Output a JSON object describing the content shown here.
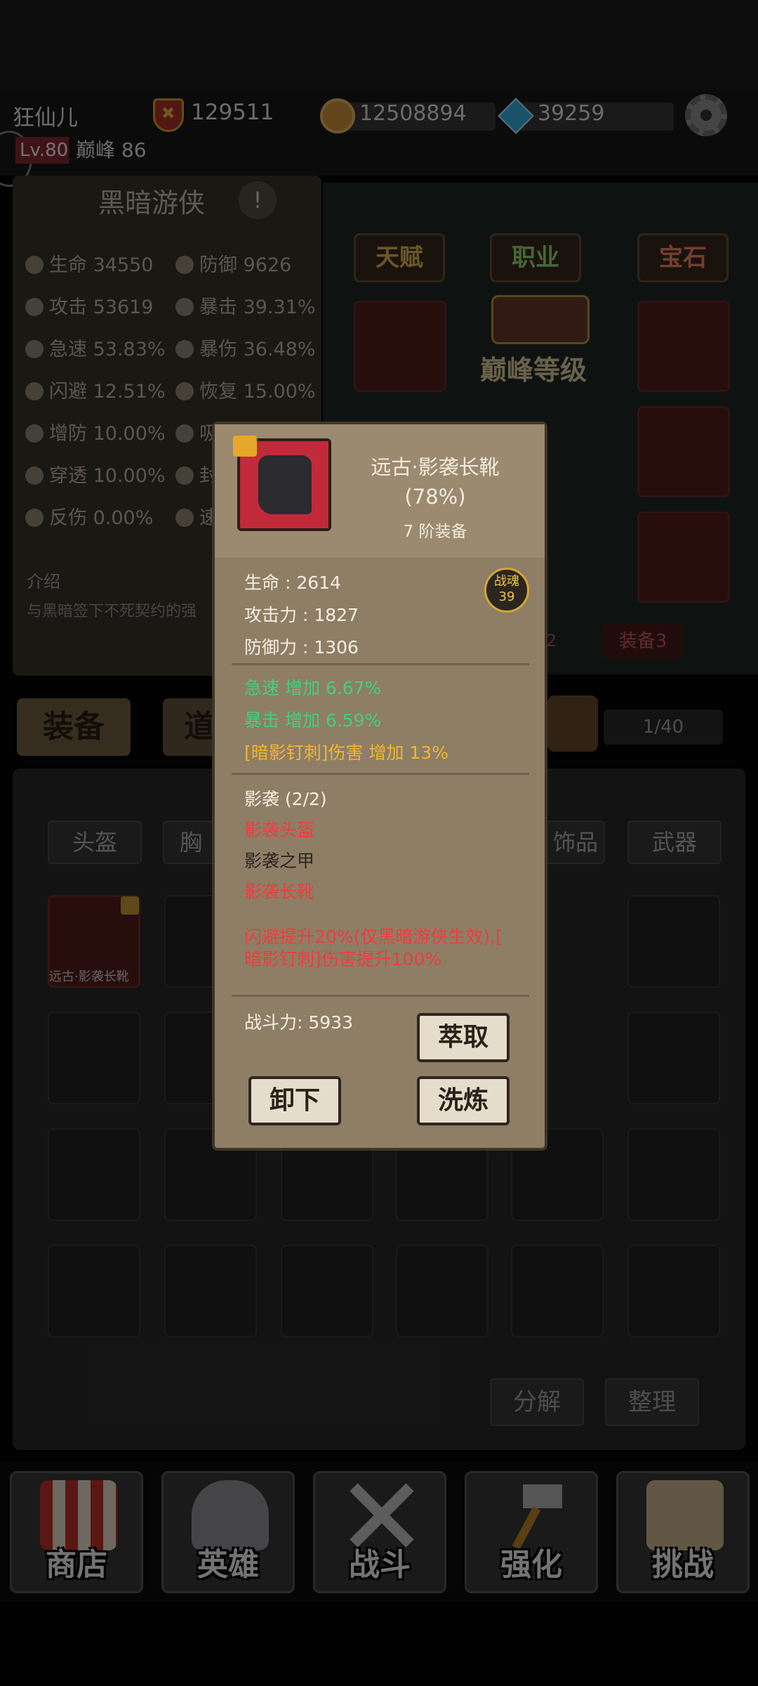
{
  "header": {
    "player_name": "狂仙儿",
    "combat_power": "129511",
    "level": "Lv.80",
    "peak": "巅峰 86",
    "gold": "12508894",
    "gems": "39259"
  },
  "hero_panel": {
    "class_name": "黑暗游侠",
    "info_icon": "!",
    "stats": [
      {
        "label": "生命 34550",
        "icon": "heart-icon"
      },
      {
        "label": "防御 9626",
        "icon": "shield-icon"
      },
      {
        "label": "攻击 53619",
        "icon": "sword-icon"
      },
      {
        "label": "暴击 39.31%",
        "icon": "crit-icon"
      },
      {
        "label": "急速 53.83%",
        "icon": "haste-icon"
      },
      {
        "label": "暴伤 36.48%",
        "icon": "critdmg-icon"
      },
      {
        "label": "闪避 12.51%",
        "icon": "dodge-icon"
      },
      {
        "label": "恢复 15.00%",
        "icon": "heal-icon"
      },
      {
        "label": "增防 10.00%",
        "icon": "defup-icon"
      },
      {
        "label": "吸",
        "icon": "lifesteal-icon"
      },
      {
        "label": "穿透 10.00%",
        "icon": "pierce-icon"
      },
      {
        "label": "封",
        "icon": "seal-icon"
      },
      {
        "label": "反伤 0.00%",
        "icon": "reflect-icon"
      },
      {
        "label": "速",
        "icon": "speed-icon"
      }
    ],
    "intro_label": "介绍",
    "intro_text": "与黑暗签下不死契约的强"
  },
  "right_menu": {
    "talent": "天赋",
    "job": "职业",
    "gem": "宝石",
    "peak_level": "巅峰等级",
    "equip_tab_partial": "2",
    "equip3": "装备3"
  },
  "tabs": {
    "equip": "装备",
    "item": "道",
    "capacity": "1/40"
  },
  "inventory": {
    "categories": [
      "头盔",
      "胸",
      "饰品",
      "武器"
    ],
    "first_item_label": "远古·影袭长靴",
    "decompose": "分解",
    "sort": "整理"
  },
  "nav": [
    {
      "label": "商店",
      "icon": "shop-icon"
    },
    {
      "label": "英雄",
      "icon": "hero-helmet-icon"
    },
    {
      "label": "战斗",
      "icon": "crossed-swords-icon"
    },
    {
      "label": "强化",
      "icon": "hammer-icon"
    },
    {
      "label": "挑战",
      "icon": "challenge-map-icon"
    }
  ],
  "popup": {
    "item_name": "远古·影袭长靴",
    "percent": "(78%)",
    "tier": "7 阶装备",
    "soul_label": "战魂",
    "soul_value": "39",
    "base_stats": [
      "生命 : 2614",
      "攻击力 : 1827",
      "防御力 : 1306"
    ],
    "bonus_stats": [
      {
        "text": "急速 增加 6.67%",
        "color": "green"
      },
      {
        "text": "暴击 增加 6.59%",
        "color": "green"
      },
      {
        "text": "[暗影钉刺]伤害 增加 13%",
        "color": "gold"
      }
    ],
    "set_name": "影袭 (2/2)",
    "set_items": [
      {
        "text": "影袭头盔",
        "color": "red"
      },
      {
        "text": "影袭之甲",
        "color": "dark"
      },
      {
        "text": "影袭长靴",
        "color": "red"
      }
    ],
    "set_effect_line1": "闪避提升20%(仅黑暗游侠生效),[",
    "set_effect_line2": "暗影钉刺]伤害提升100%",
    "power": "战斗力: 5933",
    "extract": "萃取",
    "unequip": "卸下",
    "refine": "洗炼"
  },
  "colors": {
    "popup_bg": "#8e7e66",
    "green": "#42d07a",
    "gold": "#f2b62e",
    "red": "#ee3d3d",
    "item_frame": "#c22a3a"
  }
}
